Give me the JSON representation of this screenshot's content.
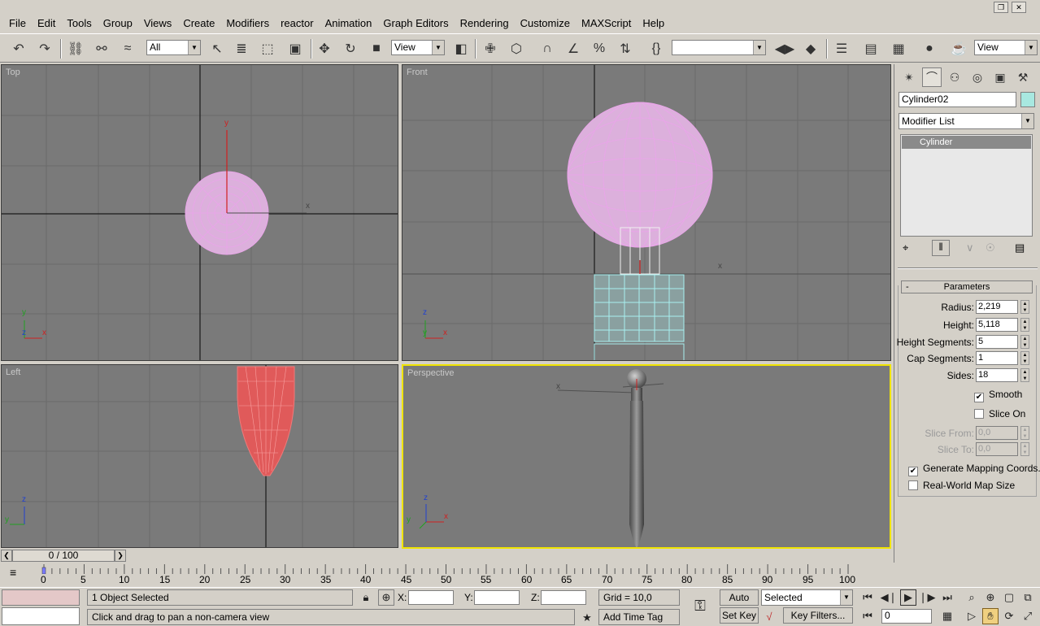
{
  "menubar": {
    "items": [
      "File",
      "Edit",
      "Tools",
      "Group",
      "Views",
      "Create",
      "Modifiers",
      "reactor",
      "Animation",
      "Graph Editors",
      "Rendering",
      "Customize",
      "MAXScript",
      "Help"
    ]
  },
  "toolbar": {
    "selection_filter": "All",
    "ref_coord": "View",
    "named_selection": "",
    "render_view": "View"
  },
  "viewports": {
    "top": {
      "label": "Top",
      "axis_x": "x",
      "axis_y": "y",
      "axis_z": "z"
    },
    "front": {
      "label": "Front",
      "axis_x": "x",
      "axis_y": "y",
      "axis_z": "z"
    },
    "left": {
      "label": "Left",
      "axis_y": "y",
      "axis_z": "z"
    },
    "perspective": {
      "label": "Perspective",
      "axis_x": "x",
      "axis_y": "y",
      "axis_z": "z"
    }
  },
  "colors": {
    "viewport_bg": "#7a7a7a",
    "active_border": "#f0e400",
    "wire_pink": "#e8a6e8",
    "wire_cyan": "#a8f0f0",
    "object_color": "#a8e8e0"
  },
  "command_panel": {
    "object_name": "Cylinder02",
    "modifier_list": "Modifier List",
    "stack": [
      "Cylinder"
    ],
    "rollout_toggle": "-",
    "rollout_title": "Parameters",
    "params": [
      {
        "label": "Radius:",
        "value": "2,219"
      },
      {
        "label": "Height:",
        "value": "5,118"
      },
      {
        "label": "Height Segments:",
        "value": "5"
      },
      {
        "label": "Cap Segments:",
        "value": "1"
      },
      {
        "label": "Sides:",
        "value": "18"
      }
    ],
    "smooth": {
      "label": "Smooth",
      "checked": true
    },
    "slice_on": {
      "label": "Slice On",
      "checked": false
    },
    "slice_from": {
      "label": "Slice From:",
      "value": "0,0"
    },
    "slice_to": {
      "label": "Slice To:",
      "value": "0,0"
    },
    "gen_mapping": {
      "label": "Generate Mapping Coords.",
      "checked": true
    },
    "real_world": {
      "label": "Real-World Map Size",
      "checked": false
    }
  },
  "timeline": {
    "frame_display": "0 / 100",
    "ticks": [
      "0",
      "5",
      "10",
      "15",
      "20",
      "25",
      "30",
      "35",
      "40",
      "45",
      "50",
      "55",
      "60",
      "65",
      "70",
      "75",
      "80",
      "85",
      "90",
      "95",
      "100"
    ]
  },
  "status": {
    "selection_status": "1 Object Selected",
    "prompt": "Click and drag to pan a non-camera view",
    "x_label": "X:",
    "y_label": "Y:",
    "z_label": "Z:",
    "x_value": "",
    "y_value": "",
    "z_value": "",
    "grid": "Grid = 10,0",
    "add_time_tag": "Add Time Tag",
    "auto_key": "Auto Key",
    "set_key": "Set Key",
    "key_mode": "Selected",
    "key_filters": "Key Filters...",
    "current_frame": "0"
  }
}
